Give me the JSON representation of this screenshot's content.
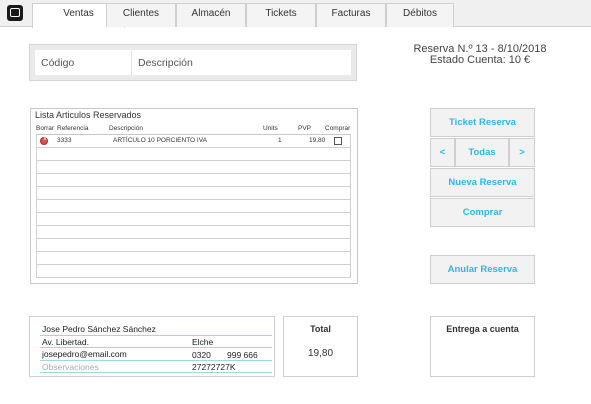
{
  "tabs": [
    "Ventas",
    "Clientes",
    "Almacén",
    "Tickets",
    "Facturas",
    "Débitos"
  ],
  "search": {
    "codigo_placeholder": "Código",
    "descripcion_placeholder": "Descripción"
  },
  "reserva": {
    "header": "Reserva N.º 13 - 8/10/2018",
    "estado": "Estado Cuenta: 10 €"
  },
  "lista": {
    "title": "Lista Articulos Reservados",
    "columns": [
      "Borrar",
      "Referencia",
      "Descripción",
      "Units",
      "PVP",
      "Comprar"
    ],
    "rows": [
      {
        "referencia": "3333",
        "descripcion": "ARTÍCULO 10 PORCIENTO IVA",
        "units": "1",
        "pvp": "19,80",
        "comprar": false
      }
    ]
  },
  "buttons": {
    "ticket_reserva": "Ticket Reserva",
    "prev": "<",
    "todas": "Todas",
    "next": ">",
    "nueva_reserva": "Nueva Reserva",
    "comprar": "Comprar",
    "anular_reserva": "Anular Reserva"
  },
  "customer": {
    "name": "Jose Pedro Sánchez Sánchez",
    "address": "Av. Libertad.",
    "city": "Elche",
    "email": "josepedro@email.com",
    "phone_prefix": "0320",
    "phone": "999 666",
    "observaciones_placeholder": "Observaciones",
    "id_number": "27272727K"
  },
  "total": {
    "label": "Total",
    "value": "19,80"
  },
  "entrega": {
    "label": "Entrega a cuenta"
  },
  "colors": {
    "accent": "#31b7e0",
    "delete": "#e05050"
  }
}
